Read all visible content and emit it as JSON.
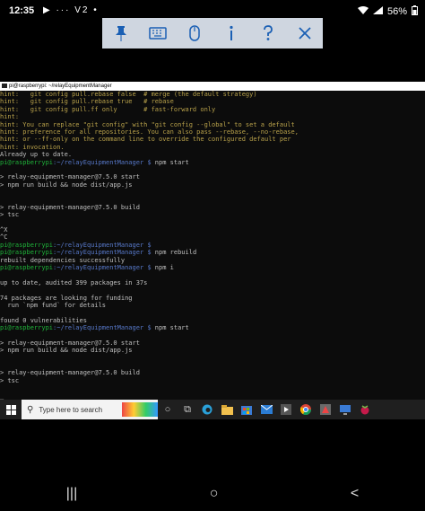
{
  "statusbar": {
    "time": "12:35",
    "left_icons": "▶ ··· V2 •",
    "battery": "56%"
  },
  "toolbar": {
    "items": [
      "pin-icon",
      "keyboard-icon",
      "mouse-icon",
      "info-icon",
      "help-icon",
      "close-icon"
    ]
  },
  "window": {
    "title": "pi@raspberrypi: ~/relayEquipmentManager"
  },
  "terminal": {
    "hint1": "hint:   git config pull.rebase false  # merge (the default strategy)",
    "hint2": "hint:   git config pull.rebase true   # rebase",
    "hint3": "hint:   git config pull.ff only       # fast-forward only",
    "hint4": "hint:",
    "hint5": "hint: You can replace \"git config\" with \"git config --global\" to set a default",
    "hint6": "hint: preference for all repositories. You can also pass --rebase, --no-rebase,",
    "hint7": "hint: or --ff-only on the command line to override the configured default per",
    "hint8": "hint: invocation.",
    "uptodate": "Already up to date.",
    "user": "pi@raspberrypi",
    "path": ":~/relayEquipmentManager $",
    "cmd_start": " npm start",
    "blank": "",
    "start1": "> relay-equipment-manager@7.5.0 start",
    "start2": "> npm run build && node dist/app.js",
    "build1": "> relay-equipment-manager@7.5.0 build",
    "build2": "> tsc",
    "ctrlx": "^X",
    "ctrlc": "^C",
    "cmd_rebuild": " npm rebuild",
    "rebuilt": "rebuilt dependencies successfully",
    "cmd_i": " npm i",
    "audited": "up to date, audited 399 packages in 37s",
    "funding1": "74 packages are looking for funding",
    "funding2": "  run `npm fund` for details",
    "vuln": "found 0 vulnerabilities",
    "cursor": "_"
  },
  "taskbar": {
    "search_placeholder": "Type here to search"
  },
  "navbar": {
    "recents": "|||",
    "home": "○",
    "back": "<"
  }
}
